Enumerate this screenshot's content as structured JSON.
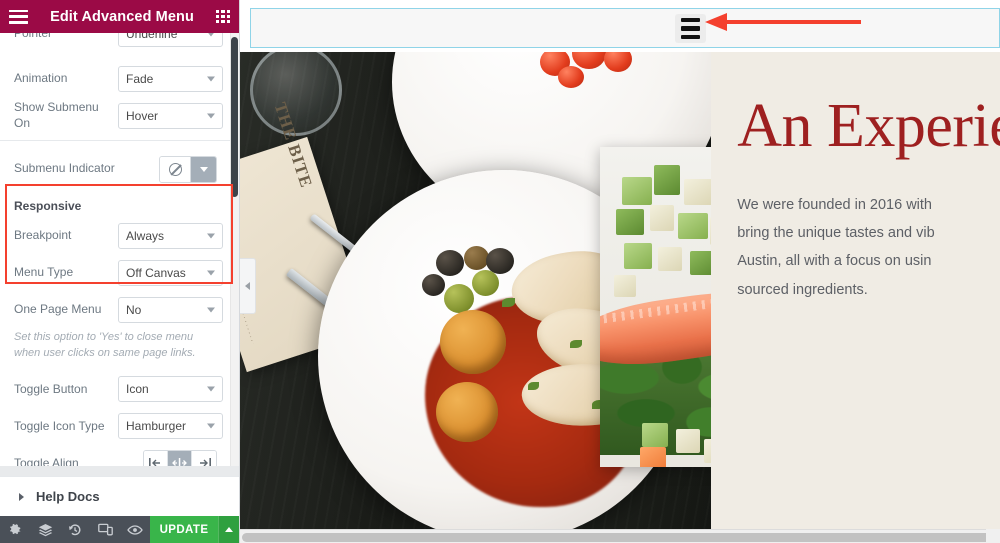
{
  "panel": {
    "header": {
      "title": "Edit Advanced Menu",
      "menu_icon": "hamburger-icon",
      "grid_icon": "widgets-grid-icon"
    },
    "clipped_row": {
      "label": "Pointer",
      "value": "Underline"
    },
    "rows": [
      {
        "label": "Animation",
        "value": "Fade"
      },
      {
        "label": "Show Submenu On",
        "value": "Hover"
      }
    ],
    "submenu_indicator": {
      "label": "Submenu Indicator",
      "icon": "none-ban-icon",
      "caret_icon": "chevron-down-icon"
    },
    "responsive": {
      "title": "Responsive",
      "breakpoint": {
        "label": "Breakpoint",
        "value": "Always"
      },
      "menu_type": {
        "label": "Menu Type",
        "value": "Off Canvas"
      }
    },
    "one_page_menu": {
      "label": "One Page Menu",
      "value": "No",
      "hint": "Set this option to 'Yes' to close menu when user clicks on same page links."
    },
    "toggle_button": {
      "label": "Toggle Button",
      "value": "Icon"
    },
    "toggle_icon_type": {
      "label": "Toggle Icon Type",
      "value": "Hamburger"
    },
    "toggle_align": {
      "label": "Toggle Align",
      "options": [
        "align-left",
        "align-center",
        "align-right"
      ],
      "selected": "align-center"
    },
    "help_docs": {
      "label": "Help Docs",
      "expand_icon": "triangle-right-icon"
    },
    "footer": {
      "icons": [
        "settings-gear-icon",
        "layers-navigator-icon",
        "history-revisions-icon",
        "responsive-mode-icon",
        "preview-eye-icon"
      ],
      "update_label": "UPDATE",
      "update_caret_icon": "chevron-up-icon"
    },
    "scrollbar": {
      "name": "panel-vertical-scrollbar"
    }
  },
  "collapse_handle": {
    "icon": "chevron-left-icon"
  },
  "canvas": {
    "nav_section": {
      "toggle_icon": "hamburger-toggle-icon",
      "annotation": {
        "type": "arrow",
        "direction": "left",
        "color": "#f4402e"
      }
    },
    "hero": {
      "heading": "An Experie",
      "paragraph_lines": [
        "We were founded in 2016 with",
        "bring the unique tastes and vib",
        "Austin, all with a focus on usin",
        "sourced ingredients."
      ],
      "menu_card_text": "THE BITE",
      "image_1": "plated-squid-and-olives-photo",
      "image_2": "salmon-with-vegetables-photo"
    },
    "horizontal_scrollbar": {
      "name": "canvas-horizontal-scrollbar"
    }
  },
  "colors": {
    "panel_header": "#9b0a46",
    "update_button": "#39b54a",
    "highlight_box": "#f4402e",
    "heading_red": "#9e2020",
    "hero_bg": "#f0ece4",
    "section_outline": "#8fd4e8"
  }
}
